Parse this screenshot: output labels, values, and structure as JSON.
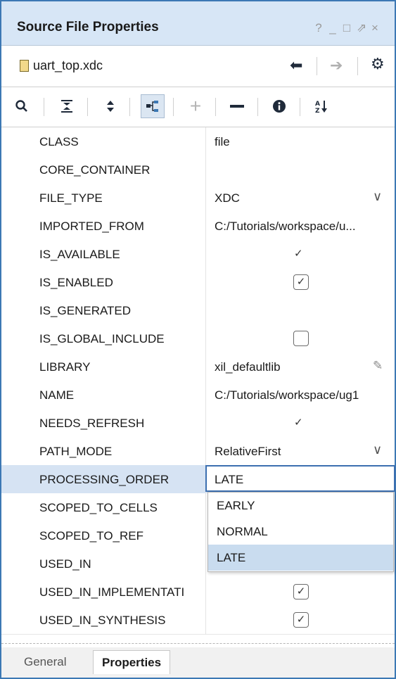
{
  "window": {
    "title": "Source File Properties",
    "controls": [
      "?",
      "_",
      "□",
      "⇗",
      "×"
    ]
  },
  "filebar": {
    "file_name": "uart_top.xdc",
    "icons": [
      "file-icon",
      "back-arrow-icon",
      "forward-arrow-icon",
      "gear-icon"
    ]
  },
  "toolbar": {
    "buttons": [
      {
        "icon": "search-icon",
        "glyph": "⚲"
      },
      {
        "icon": "collapse-all-icon",
        "glyph": "⩡"
      },
      {
        "icon": "expand-all-icon",
        "glyph": "⬍"
      },
      {
        "icon": "group-hierarchy-icon",
        "glyph": "⊣"
      },
      {
        "icon": "add-icon",
        "glyph": "+"
      },
      {
        "icon": "remove-icon",
        "glyph": "—"
      },
      {
        "icon": "info-icon",
        "glyph": "i"
      },
      {
        "icon": "sort-az-icon",
        "glyph": "A↓Z"
      }
    ]
  },
  "properties": [
    {
      "name": "CLASS",
      "value": "file"
    },
    {
      "name": "CORE_CONTAINER",
      "value": ""
    },
    {
      "name": "FILE_TYPE",
      "value": "XDC",
      "control": "dropdown"
    },
    {
      "name": "IMPORTED_FROM",
      "value": "C:/Tutorials/workspace/u..."
    },
    {
      "name": "IS_AVAILABLE",
      "value": "",
      "control": "check"
    },
    {
      "name": "IS_ENABLED",
      "value": "",
      "control": "checkbox",
      "checked": true
    },
    {
      "name": "IS_GENERATED",
      "value": ""
    },
    {
      "name": "IS_GLOBAL_INCLUDE",
      "value": "",
      "control": "checkbox",
      "checked": false
    },
    {
      "name": "LIBRARY",
      "value": "xil_defaultlib",
      "control": "edit"
    },
    {
      "name": "NAME",
      "value": "C:/Tutorials/workspace/ug1"
    },
    {
      "name": "NEEDS_REFRESH",
      "value": "",
      "control": "check"
    },
    {
      "name": "PATH_MODE",
      "value": "RelativeFirst",
      "control": "dropdown"
    },
    {
      "name": "PROCESSING_ORDER",
      "value": "LATE",
      "control": "editing",
      "selected": true
    },
    {
      "name": "SCOPED_TO_CELLS",
      "value": ""
    },
    {
      "name": "SCOPED_TO_REF",
      "value": ""
    },
    {
      "name": "USED_IN",
      "value": ""
    },
    {
      "name": "USED_IN_IMPLEMENTATI",
      "value": "",
      "control": "checkbox",
      "checked": true
    },
    {
      "name": "USED_IN_SYNTHESIS",
      "value": "",
      "control": "checkbox",
      "checked": true
    }
  ],
  "dropdown_options": [
    {
      "label": "EARLY",
      "selected": false
    },
    {
      "label": "NORMAL",
      "selected": false
    },
    {
      "label": "LATE",
      "selected": true
    }
  ],
  "tabs": [
    {
      "label": "General",
      "active": false
    },
    {
      "label": "Properties",
      "active": true
    }
  ],
  "colors": {
    "accent": "#3c78b4",
    "titlebar_bg": "#d7e6f6",
    "selected_row": "#d6e3f3",
    "selected_option": "#c9dcef"
  }
}
